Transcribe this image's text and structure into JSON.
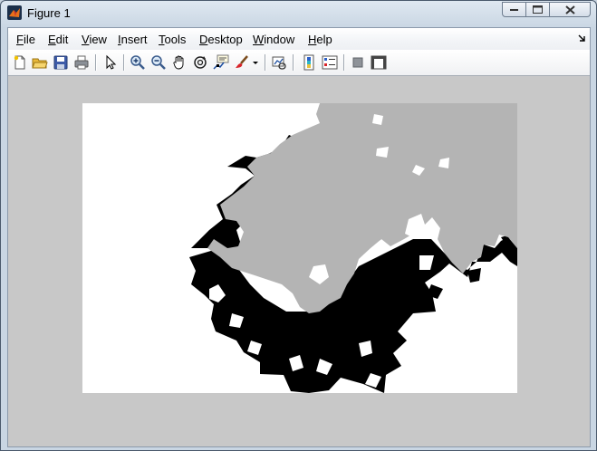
{
  "window": {
    "title": "Figure 1"
  },
  "menu": {
    "items": [
      {
        "key": "file",
        "label": "File"
      },
      {
        "key": "edit",
        "label": "Edit"
      },
      {
        "key": "view",
        "label": "View"
      },
      {
        "key": "insert",
        "label": "Insert"
      },
      {
        "key": "tools",
        "label": "Tools"
      },
      {
        "key": "desktop",
        "label": "Desktop"
      },
      {
        "key": "window",
        "label": "Window"
      },
      {
        "key": "help",
        "label": "Help"
      }
    ]
  },
  "toolbar": {
    "icons": [
      "new-figure-icon",
      "open-file-icon",
      "save-icon",
      "print-icon",
      "edit-plot-arrow-icon",
      "zoom-in-icon",
      "zoom-out-icon",
      "pan-hand-icon",
      "rotate-3d-icon",
      "data-cursor-icon",
      "brush-icon",
      "brush-dropdown-icon",
      "link-plot-icon",
      "insert-colorbar-icon",
      "insert-legend-icon",
      "hide-plot-tools-icon",
      "show-plot-tools-icon"
    ]
  },
  "colors": {
    "region_gray": "#b4b4b4",
    "region_black": "#000000",
    "background": "#ffffff",
    "figure_bg": "#c8c8c8"
  }
}
